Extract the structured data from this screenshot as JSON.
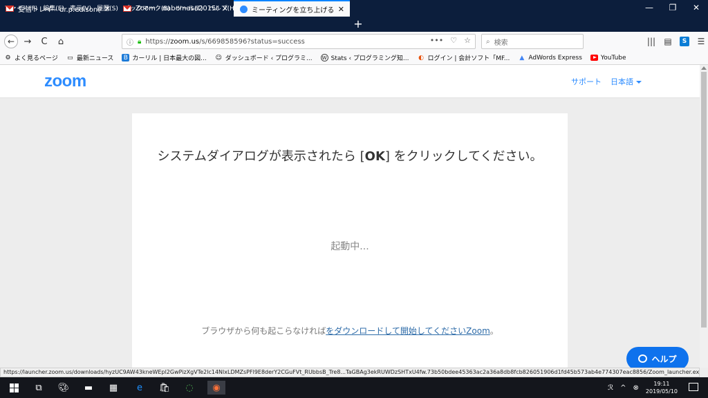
{
  "menu": [
    "ファイル(F)",
    "編集(E)",
    "表示(V)",
    "履歴(S)",
    "ブックマーク(B)",
    "ツール(T)",
    "ヘルプ(H)"
  ],
  "window_controls": {
    "minimize": "—",
    "restore": "❐",
    "close": "✕"
  },
  "tabs": [
    {
      "label": "受信トレイ - dr.p.edison@gmail.",
      "close": "✕"
    },
    {
      "label": "Zoom - nabemasa2015@gmail.",
      "close": "✕"
    },
    {
      "label": "ミーティングを立ち上げる - Zoom",
      "close": "✕"
    }
  ],
  "new_tab": "+",
  "nav": {
    "back": "←",
    "forward": "→",
    "reload": "C",
    "home": "⌂",
    "url_prefix": "https://",
    "url_host": "zoom.us",
    "url_path": "/s/669858596?status=success",
    "page_actions": "•••",
    "search_placeholder": "検索"
  },
  "bookmarks": [
    {
      "label": "よく見るページ",
      "icon": "gear-icon"
    },
    {
      "label": "最新ニュース",
      "icon": "folder-icon"
    },
    {
      "label": "カーリル | 日本最大の図...",
      "icon": "calil-icon"
    },
    {
      "label": "ダッシュボード ‹ プログラミ...",
      "icon": "avatar-icon"
    },
    {
      "label": "Stats ‹ プログラミング知...",
      "icon": "wordpress-icon"
    },
    {
      "label": "ログイン | 会計ソフト「MF...",
      "icon": "mf-icon"
    },
    {
      "label": "AdWords Express",
      "icon": "adwords-icon"
    },
    {
      "label": "YouTube",
      "icon": "youtube-icon"
    }
  ],
  "header": {
    "logo": "zoom",
    "support": "サポート",
    "language": "日本語"
  },
  "card": {
    "title_before": "システムダイアログが表示されたら [",
    "title_bold": "OK",
    "title_after": "] をクリックしてください。",
    "launching": "起動中...",
    "footer_before": "ブラウザから何も起こらなければ",
    "footer_link_1": "をダウンロードして",
    "footer_link_2": "開始してくださいZoom",
    "footer_after": "。"
  },
  "help_button": "ヘルプ",
  "status_url": "https://launcher.zoom.us/downloads/hyzUC9AW43kneWEpl2GwPizXgVTe2lc14NlxLDMZsPFl9E8derY2CGuFVt_RUbbsB_Tre8...TaGBAg3ekRUWDzSHTxU4fw.73b50bdee45363ac2a36a8db8fcb826051906d1fd45b573ab4e774307eac8856/Zoom_launcher.exe",
  "clock": {
    "time": "19:11",
    "date": "2019/05/10"
  },
  "colors": {
    "zoom_blue": "#2d8cff",
    "help_blue": "#0e72ed",
    "titlebar": "#0c1e3c"
  }
}
